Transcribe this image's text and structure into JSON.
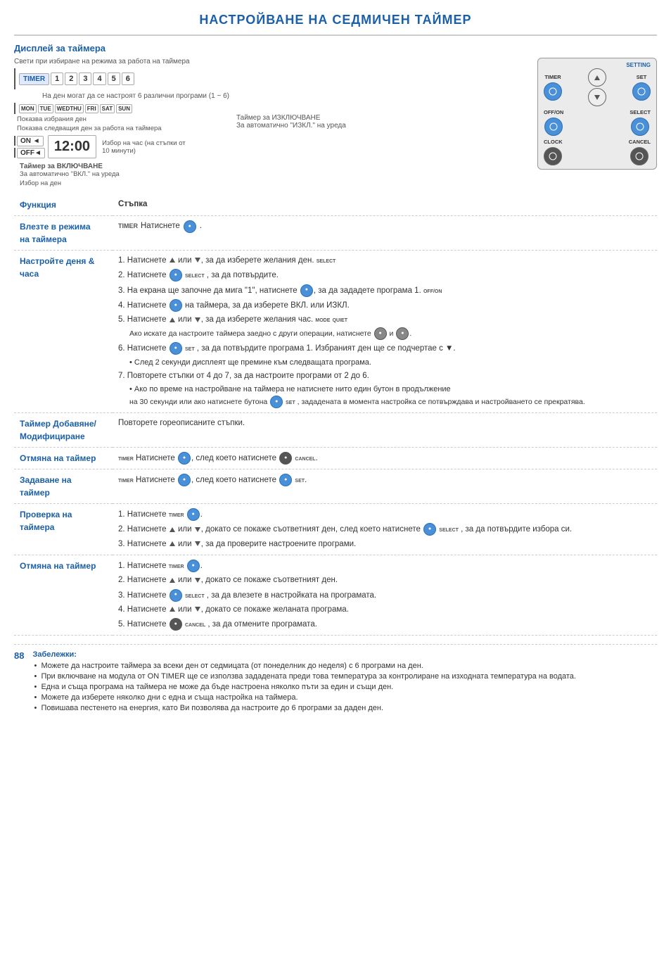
{
  "page": {
    "title": "НАСТРОЙВАНЕ НА СЕДМИЧЕН ТАЙМЕР",
    "page_number": "88"
  },
  "display_section": {
    "title": "Дисплей за таймера",
    "annotation1": "Свети при избиране на режима за работа на таймера",
    "annotation2": "На ден могат да се настроят 6 различни програми (1 ~ 6)",
    "annotation3": "Показва избрания ден",
    "annotation4": "Показва следващия ден за работа на таймера",
    "annotation5": "Избор на час (на стъпки от 10 минути)",
    "annotation6": "Таймер за ИЗКЛЮЧВАНЕ",
    "annotation7": "За автоматично \"ИЗКЛ.\" на уреда",
    "annotation8": "Таймер за ВКЛЮЧВАНЕ",
    "annotation9": "За автоматично \"ВКЛ.\" на уреда",
    "annotation10": "Избор на ден",
    "timer_label": "TIMER",
    "setting_label": "SETTING",
    "set_label": "SET",
    "select_label": "SELECT",
    "cancel_label": "CANCEL",
    "offon_label": "OFF/ON",
    "clock_label": "CLOCK"
  },
  "table": {
    "col1_header": "Функция",
    "col2_header": "Стъпка",
    "rows": [
      {
        "func": "Влезте в режима на таймера",
        "steps": [
          {
            "text": "Натиснете TIMER бутона."
          }
        ]
      },
      {
        "func": "Настройте деня & часа",
        "steps": [
          {
            "num": "1.",
            "text": "Натиснете ▲ или ▼, за да изберете желания ден."
          },
          {
            "num": "2.",
            "text": "Натиснете SELECT, за да потвърдите."
          },
          {
            "num": "3.",
            "text": "На екрана ще започне да мига \"1\", натиснете SELECT, за да зададете програма 1."
          },
          {
            "num": "4.",
            "text": "Натиснете OFF/ON на таймера, за да изберете ВКЛ. или ИЗКЛ."
          },
          {
            "num": "5.",
            "text": "Натиснете ▲ или ▼, за да изберете желания час."
          },
          {
            "text": "Ако искате да настроите таймера заедно с други операции, натиснете MODE и QUIET."
          },
          {
            "num": "6.",
            "text": "Натиснете SET, за да потвърдите програма 1. Избраният ден ще се подчертае с ▼."
          },
          {
            "bullet": "• След 2 секунди дисплеят ще премине към следващата програма."
          },
          {
            "num": "7.",
            "text": "Повторете стъпки от 4 до 7, за да настроите програми от 2 до 6."
          },
          {
            "bullet": "• Ако по време на настройване на таймера не натиснете нито един бутон в продължение"
          },
          {
            "text": "на 30 секунди или ако натиснете бутона SET, зададената в момента настройка се потвърждава и настройването се прекратява."
          }
        ]
      },
      {
        "func": "Таймер Добавяне/ Модифициране",
        "steps": [
          {
            "text": "Повторете гореописаните стъпки."
          }
        ]
      },
      {
        "func": "Отмяна на таймер",
        "steps": [
          {
            "text": "Натиснете TIMER, след което натиснете CANCEL."
          }
        ]
      },
      {
        "func": "Задаване на таймер",
        "steps": [
          {
            "text": "Натиснете TIMER, след което натиснете SET."
          }
        ]
      },
      {
        "func": "Проверка на таймера",
        "steps": [
          {
            "num": "1.",
            "text": "Натиснете TIMER."
          },
          {
            "num": "2.",
            "text": "Натиснете ▲ или ▼, докато се покаже съответният ден, след което натиснете SELECT, за да потвърдите избора си."
          },
          {
            "num": "3.",
            "text": "Натиснете ▲ или ▼, за да проверите настроените програми."
          }
        ]
      },
      {
        "func": "Отмяна на таймер",
        "steps": [
          {
            "num": "1.",
            "text": "Натиснете TIMER."
          },
          {
            "num": "2.",
            "text": "Натиснете ▲ или ▼, докато се покаже съответният ден."
          },
          {
            "num": "3.",
            "text": "Натиснете SELECT, за да влезете в настройката на програмата."
          },
          {
            "num": "4.",
            "text": "Натиснете ▲ или ▼, докато се покаже желаната програма."
          },
          {
            "num": "5.",
            "text": "Натиснете CANCEL, за да отмените програмата."
          }
        ]
      }
    ]
  },
  "notes": {
    "title": "Забележки:",
    "items": [
      "Можете да настроите таймера за всеки ден от седмицата (от понеделник до неделя) с 6 програми на ден.",
      "При включване на модула от ON TIMER ще се използва зададената преди това температура за контролиране на изходната температура на водата.",
      "Една и съща програма на таймера не може да бъде настроена няколко пъти за един и същи ден.",
      "Можете да изберете няколко дни с една и съща настройка на таймера.",
      "Повишава пестенето на енергия, като Ви позволява да настроите до 6 програми за даден ден."
    ]
  }
}
